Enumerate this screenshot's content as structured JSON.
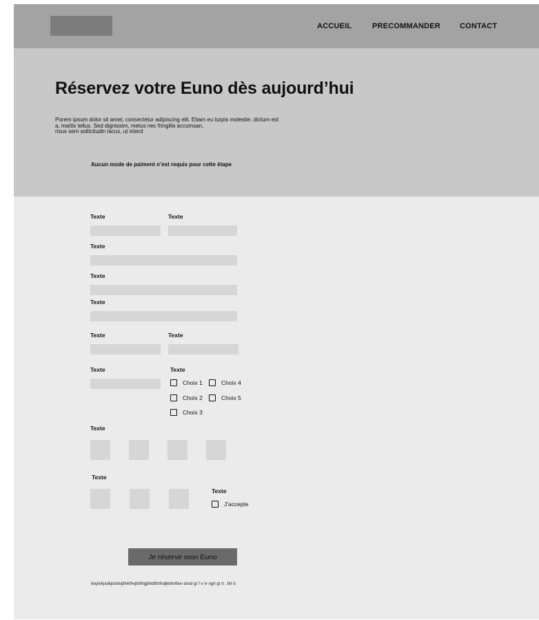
{
  "header": {
    "nav": [
      "ACCUEIL",
      "PRECOMMANDER",
      "CONTACT"
    ]
  },
  "hero": {
    "title": "Réservez votre Euno dès aujourd’hui",
    "description_lines": [
      "Porem ipsum dolor sit amet, consectetur adipiscing elit. Etiam eu turpis molestie, dictum est",
      "a, mattis tellus. Sed dignissim, metus nec fringilla accumsan,",
      "risus sem sollicitudin lacus, ut interd"
    ],
    "note": "Aucun mode de paiment n’est requis pour cette étape"
  },
  "form": {
    "label": "Texte",
    "checkboxes": [
      "Choix 1",
      "Choix 2",
      "Choix 3",
      "Choix 4",
      "Choix 5"
    ],
    "accept": "J'accepte",
    "submit": "Je réserve mon Euno",
    "footnote": "ikxjdvkjxdkjdsklvjdfvkfhvjkbfhgjbhdfbhfndjkbhvfbvv dsvd gr f v vr vgrt gt rt . btr b"
  }
}
